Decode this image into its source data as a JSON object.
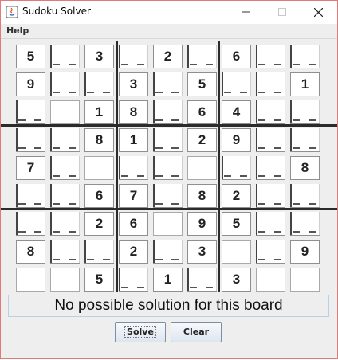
{
  "window": {
    "title": "Sudoku Solver"
  },
  "menu": {
    "items": [
      "Help"
    ]
  },
  "board": {
    "rows": [
      [
        "5",
        "_",
        "3",
        "_",
        "2",
        "_",
        "6",
        "_",
        "_"
      ],
      [
        "9",
        "_",
        "_",
        "3",
        "_",
        "5",
        "_",
        "_",
        "1"
      ],
      [
        "_",
        "",
        "1",
        "8",
        "_",
        "6",
        "4",
        "_",
        "_"
      ],
      [
        "_",
        "_",
        "8",
        "1",
        "_",
        "2",
        "9",
        "_",
        "_"
      ],
      [
        "7",
        "_",
        "",
        "_",
        "_",
        "",
        "_",
        "_",
        "8"
      ],
      [
        "_",
        "_",
        "6",
        "7",
        "_",
        "8",
        "2",
        "_",
        "_"
      ],
      [
        "_",
        "_",
        "2",
        "6",
        "",
        "9",
        "5",
        "_",
        "_"
      ],
      [
        "8",
        "_",
        "_",
        "2",
        "_",
        "3",
        "",
        "_",
        "9"
      ],
      [
        "",
        "",
        "5",
        "_",
        "1",
        "_",
        "3",
        "",
        ""
      ]
    ]
  },
  "status": {
    "message": "No possible solution for this board"
  },
  "buttons": {
    "solve": "Solve",
    "clear": "Clear"
  }
}
